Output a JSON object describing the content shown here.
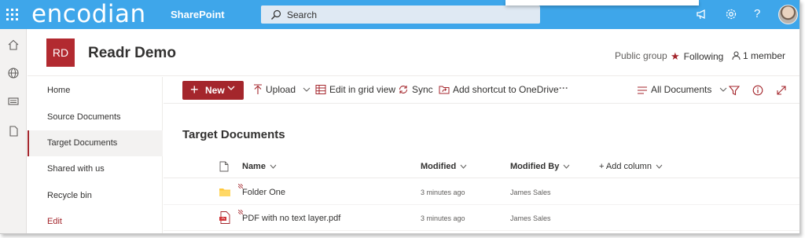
{
  "suite_bar": {
    "brand": "encodian",
    "app_name": "SharePoint",
    "search_placeholder": "Search",
    "accent_color": "#3ea6ea",
    "help_glyph": "?"
  },
  "site": {
    "logo_text": "RD",
    "title": "Readr Demo",
    "group_type": "Public group",
    "following_label": "Following",
    "members_label": "1 member",
    "brand_color": "#a4262c"
  },
  "quick_launch": {
    "items": [
      {
        "label": "Home"
      },
      {
        "label": "Source Documents"
      },
      {
        "label": "Target Documents"
      },
      {
        "label": "Shared with us"
      },
      {
        "label": "Recycle bin"
      },
      {
        "label": "Edit"
      }
    ],
    "active": "Target Documents"
  },
  "command_bar": {
    "new_label": "New",
    "upload_label": "Upload",
    "grid_view_label": "Edit in grid view",
    "sync_label": "Sync",
    "shortcut_label": "Add shortcut to OneDrive",
    "more_glyph": "···",
    "view_label": "All Documents"
  },
  "library": {
    "title": "Target Documents",
    "columns": {
      "name": "Name",
      "modified": "Modified",
      "modified_by": "Modified By",
      "add_column": "+ Add column"
    },
    "rows": [
      {
        "type_icon": "folder-icon",
        "name": "Folder One",
        "modified": "3 minutes ago",
        "modified_by": "James Sales"
      },
      {
        "type_icon": "pdf-file-icon",
        "name": "PDF with no text layer.pdf",
        "modified": "3 minutes ago",
        "modified_by": "James Sales"
      }
    ]
  }
}
